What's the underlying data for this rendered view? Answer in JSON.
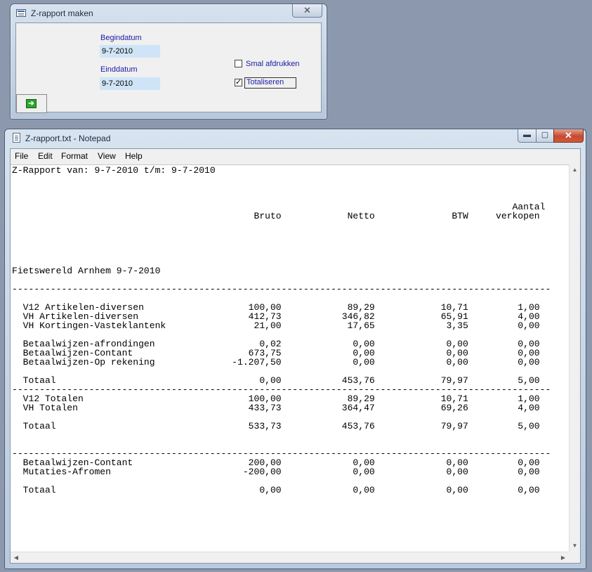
{
  "dialog": {
    "title": "Z-rapport maken",
    "close_glyph": "✕",
    "begindatum_label": "Begindatum",
    "begindatum_value": "9-7-2010",
    "einddatum_label": "Einddatum",
    "einddatum_value": "9-7-2010",
    "smal_afdrukken_label": "Smal afdrukken",
    "smal_afdrukken_checked": "",
    "totaliseren_label": "Totaliseren",
    "totaliseren_checked": "✓",
    "go_button_icon": "arrow-right-icon",
    "go_glyph": "➔"
  },
  "notepad": {
    "title": "Z-rapport.txt - Notepad",
    "caption_minimize": "▬",
    "caption_maximize": "▢",
    "caption_close": "✕",
    "menu": [
      "File",
      "Edit",
      "Format",
      "View",
      "Help"
    ],
    "scroll_glyphs": {
      "up": "▲",
      "down": "▼",
      "left": "◀",
      "right": "▶"
    },
    "report_lines": [
      "Z-Rapport van: 9-7-2010 t/m: 9-7-2010",
      "",
      "",
      "",
      "                                                                                           Aantal",
      "                                            Bruto            Netto              BTW     verkopen",
      "",
      "",
      "",
      "",
      "",
      "Fietswereld Arnhem 9-7-2010",
      "",
      "--------------------------------------------------------------------------------------------------",
      "",
      "  V12 Artikelen-diversen                   100,00            89,29            10,71         1,00",
      "  VH Artikelen-diversen                    412,73           346,82            65,91         4,00",
      "  VH Kortingen-Vasteklantenk                21,00            17,65             3,35         0,00",
      "",
      "  Betaalwijzen-afrondingen                   0,02             0,00             0,00         0,00",
      "  Betaalwijzen-Contant                     673,75             0,00             0,00         0,00",
      "  Betaalwijzen-Op rekening              -1.207,50             0,00             0,00         0,00",
      "",
      "  Totaal                                     0,00           453,76            79,97         5,00",
      "--------------------------------------------------------------------------------------------------",
      "  V12 Totalen                              100,00            89,29            10,71         1,00",
      "  VH Totalen                               433,73           364,47            69,26         4,00",
      "",
      "  Totaal                                   533,73           453,76            79,97         5,00",
      "",
      "",
      "--------------------------------------------------------------------------------------------------",
      "  Betaalwijzen-Contant                     200,00             0,00             0,00         0,00",
      "  Mutaties-Afromen                        -200,00             0,00             0,00         0,00",
      "",
      "  Totaal                                     0,00             0,00             0,00         0,00"
    ]
  }
}
